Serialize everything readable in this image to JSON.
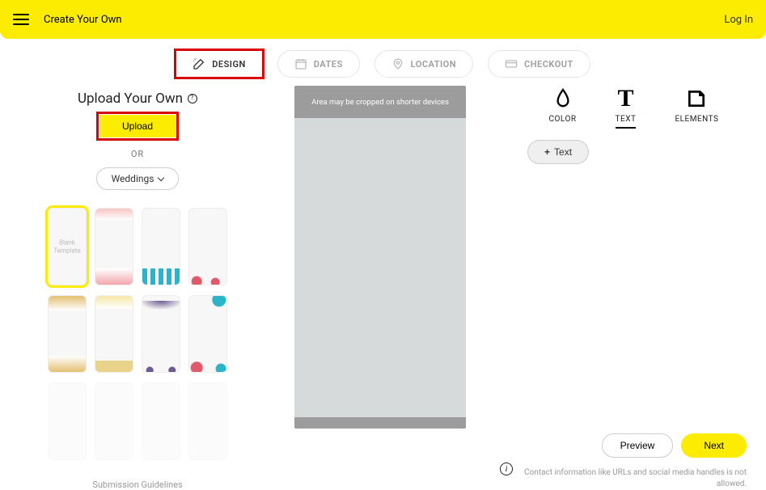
{
  "header": {
    "title": "Create Your Own",
    "login": "Log In"
  },
  "stepper": {
    "design": "DESIGN",
    "dates": "DATES",
    "location": "LOCATION",
    "checkout": "CHECKOUT"
  },
  "left": {
    "title": "Upload Your Own",
    "upload_btn": "Upload",
    "or": "OR",
    "category": "Weddings",
    "blank_tpl": "Blank Template",
    "guidelines": "Submission Guidelines"
  },
  "canvas": {
    "crop_msg": "Area may be cropped on shorter devices"
  },
  "tools": {
    "color": "COLOR",
    "text": "TEXT",
    "elements": "ELEMENTS",
    "add_text": "Text"
  },
  "actions": {
    "preview": "Preview",
    "next": "Next",
    "disclaimer": "Contact information like URLs and social media handles is not allowed."
  }
}
